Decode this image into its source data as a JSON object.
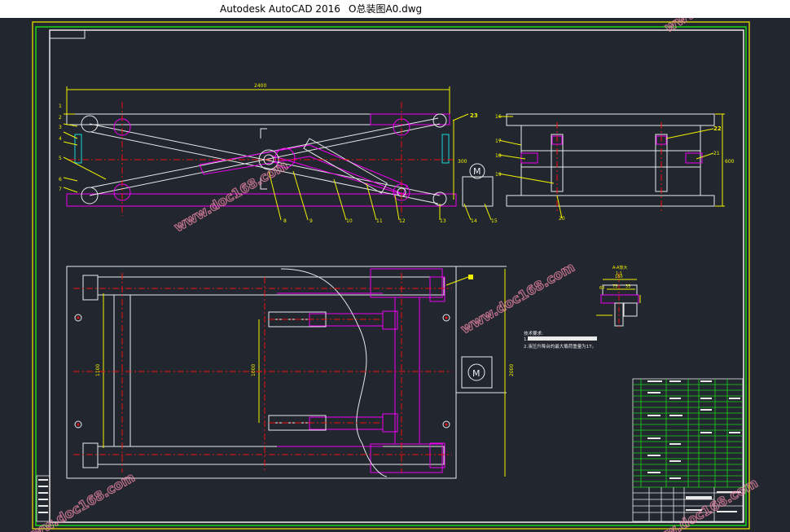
{
  "window": {
    "app_name": "Autodesk AutoCAD 2016",
    "file_name": "O总装图A0.dwg"
  },
  "colors": {
    "background": "#21262f",
    "white": "#e9e9e9",
    "yellow": "#f2f200",
    "green": "#18d618",
    "magenta": "#f000f0",
    "red": "#f01010",
    "cyan": "#16d8d8"
  },
  "icons": {
    "motor_symbol": "M"
  },
  "front_view": {
    "width_dim": "2400",
    "height_dim": "300",
    "balloons_left": [
      "1",
      "2",
      "3",
      "4",
      "5",
      "6",
      "7"
    ],
    "balloons_bottom": [
      "8",
      "9",
      "10",
      "11",
      "12",
      "13",
      "14",
      "15"
    ],
    "balloon_right": "23"
  },
  "side_view": {
    "height_dim": "600",
    "balloons": [
      "16",
      "17",
      "18",
      "19",
      "20",
      "21",
      "22"
    ]
  },
  "plan_view": {
    "width_dim": "2000",
    "inner_dim": "1000",
    "left_dim": "1100"
  },
  "detail": {
    "label": "A-A放大",
    "scale": "1:1",
    "dim_top": "160",
    "dim_mid": "60",
    "dim_a": "75",
    "dim_b": "35"
  },
  "notes": {
    "title": "技术要求:",
    "line1": "1.",
    "line2": "2.液压升降台的最大载荷重量为1T。"
  },
  "watermark": "www.doc168.com"
}
